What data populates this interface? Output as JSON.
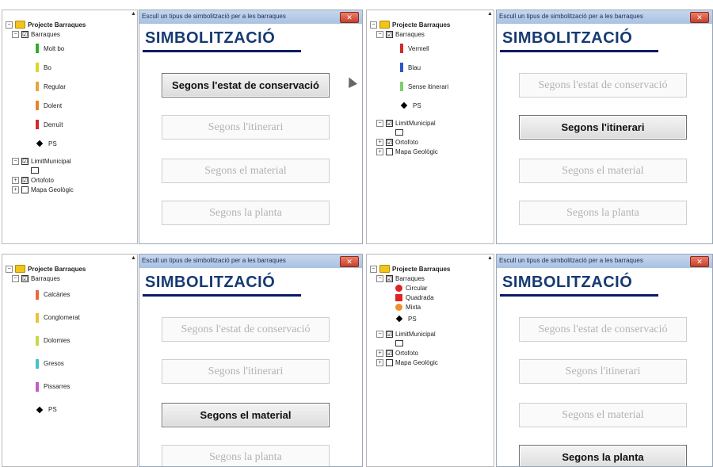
{
  "shared": {
    "project": "Projecte Barraques",
    "layers": {
      "barraques": "Barraques",
      "limit": "LimitMunicipal",
      "ortofoto": "Ortofoto",
      "geologic": "Mapa Geològic"
    },
    "dialog_title": "Escull un tipus de simbolització per a les barraques",
    "heading": "SIMBOLITZACIÓ",
    "buttons": {
      "estat": "Segons l'estat de conservació",
      "itinerari": "Segons l'itinerari",
      "material": "Segons el material",
      "planta": "Segons la planta"
    }
  },
  "legends": {
    "estat": [
      "Molt bo",
      "Bo",
      "Regular",
      "Dolent",
      "Derruït",
      "PS"
    ],
    "itinerari": [
      "Vermell",
      "Blau",
      "Sense itinerari",
      "PS"
    ],
    "material": [
      "Calcàries",
      "Conglomerat",
      "Dolomies",
      "Gresos",
      "Pissarres",
      "PS"
    ],
    "planta": [
      "Circular",
      "Quadrada",
      "Mixta",
      "PS"
    ]
  },
  "colors": {
    "estat": [
      "#2fae2f",
      "#d9d92a",
      "#e8a73a",
      "#e8852b",
      "#d12a2a"
    ],
    "itinerari": [
      "#d12a2a",
      "#2a58c8",
      "#7fd06a"
    ],
    "material": [
      "#e86a3a",
      "#e8c23a",
      "#c9d64a",
      "#46c2c8",
      "#c85ac8"
    ],
    "planta": [
      "#e02424",
      "#e02424",
      "#f0902a"
    ]
  },
  "icons": [
    "expand-collapse-icon",
    "checkbox-icon",
    "folder-icon",
    "close-icon",
    "mouse-cursor-icon"
  ]
}
